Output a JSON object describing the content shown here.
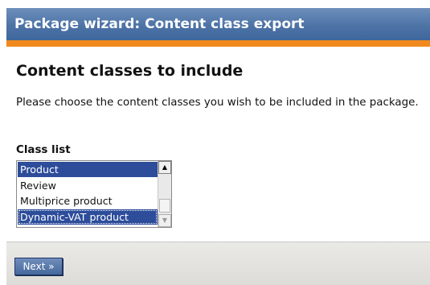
{
  "header": {
    "title": "Package wizard: Content class export"
  },
  "main": {
    "heading": "Content classes to include",
    "description": "Please choose the content classes you wish to be included in the package.",
    "class_list": {
      "label": "Class list",
      "options": [
        {
          "label": "Product",
          "selected": true
        },
        {
          "label": "Review",
          "selected": false
        },
        {
          "label": "Multiprice product",
          "selected": false
        },
        {
          "label": "Dynamic-VAT product",
          "selected": true
        }
      ],
      "scroll_up_icon": "triangle-up-icon",
      "scroll_down_icon": "triangle-down-icon"
    }
  },
  "footer": {
    "next_label": "Next »"
  },
  "colors": {
    "header_bg": "#4d73a6",
    "accent_bar": "#f08a1d",
    "selection_bg": "#2d4d9a",
    "footer_bg": "#e2e1dd",
    "button_bg": "#5574a8"
  }
}
